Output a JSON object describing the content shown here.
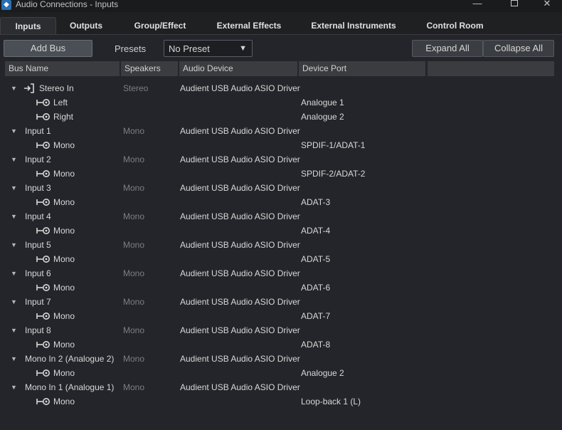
{
  "window": {
    "title": "Audio Connections - Inputs",
    "minimize_glyph": "—",
    "close_glyph": "✕"
  },
  "tabs": [
    {
      "label": "Inputs",
      "active": true
    },
    {
      "label": "Outputs"
    },
    {
      "label": "Group/Effect"
    },
    {
      "label": "External Effects"
    },
    {
      "label": "External Instruments"
    },
    {
      "label": "Control Room"
    }
  ],
  "toolbar": {
    "add_bus_label": "Add Bus",
    "presets_label": "Presets",
    "preset_value": "No Preset",
    "expand_all_label": "Expand All",
    "collapse_all_label": "Collapse All"
  },
  "columns": {
    "bus_name": "Bus Name",
    "speakers": "Speakers",
    "audio_device": "Audio Device",
    "device_port": "Device Port"
  },
  "icons": {
    "expander": "triangle-down-icon",
    "bus": "input-bus-icon",
    "channel": "input-channel-icon"
  },
  "buses": [
    {
      "name": "Stereo In",
      "speakers": "Stereo",
      "device": "Audient USB Audio ASIO Driver",
      "has_icon": true,
      "channels": [
        {
          "name": "Left",
          "port": "Analogue 1"
        },
        {
          "name": "Right",
          "port": "Analogue 2"
        }
      ]
    },
    {
      "name": "Input 1",
      "speakers": "Mono",
      "device": "Audient USB Audio ASIO Driver",
      "channels": [
        {
          "name": "Mono",
          "port": "SPDIF-1/ADAT-1"
        }
      ]
    },
    {
      "name": "Input 2",
      "speakers": "Mono",
      "device": "Audient USB Audio ASIO Driver",
      "channels": [
        {
          "name": "Mono",
          "port": "SPDIF-2/ADAT-2"
        }
      ]
    },
    {
      "name": "Input 3",
      "speakers": "Mono",
      "device": "Audient USB Audio ASIO Driver",
      "channels": [
        {
          "name": "Mono",
          "port": "ADAT-3"
        }
      ]
    },
    {
      "name": "Input 4",
      "speakers": "Mono",
      "device": "Audient USB Audio ASIO Driver",
      "channels": [
        {
          "name": "Mono",
          "port": "ADAT-4"
        }
      ]
    },
    {
      "name": "Input 5",
      "speakers": "Mono",
      "device": "Audient USB Audio ASIO Driver",
      "channels": [
        {
          "name": "Mono",
          "port": "ADAT-5"
        }
      ]
    },
    {
      "name": "Input 6",
      "speakers": "Mono",
      "device": "Audient USB Audio ASIO Driver",
      "channels": [
        {
          "name": "Mono",
          "port": "ADAT-6"
        }
      ]
    },
    {
      "name": "Input 7",
      "speakers": "Mono",
      "device": "Audient USB Audio ASIO Driver",
      "channels": [
        {
          "name": "Mono",
          "port": "ADAT-7"
        }
      ]
    },
    {
      "name": "Input 8",
      "speakers": "Mono",
      "device": "Audient USB Audio ASIO Driver",
      "channels": [
        {
          "name": "Mono",
          "port": "ADAT-8"
        }
      ]
    },
    {
      "name": "Mono In 2 (Analogue 2)",
      "speakers": "Mono",
      "device": "Audient USB Audio ASIO Driver",
      "channels": [
        {
          "name": "Mono",
          "port": "Analogue 2"
        }
      ]
    },
    {
      "name": "Mono In 1 (Analogue 1)",
      "speakers": "Mono",
      "device": "Audient USB Audio ASIO Driver",
      "channels": [
        {
          "name": "Mono",
          "port": "Loop-back 1 (L)"
        }
      ]
    }
  ]
}
